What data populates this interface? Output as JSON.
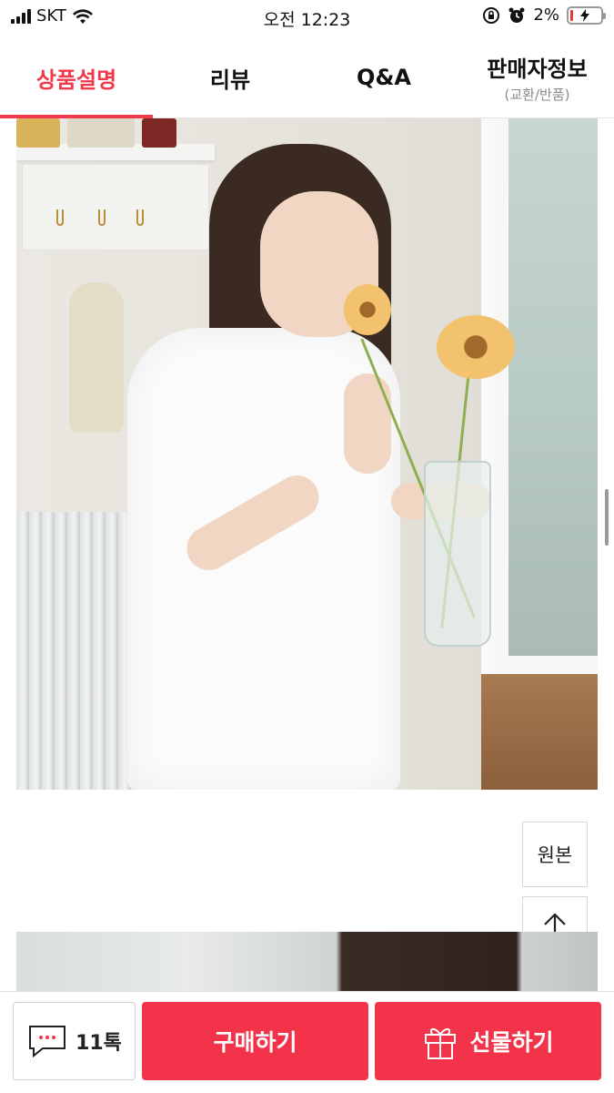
{
  "status_bar": {
    "carrier": "SKT",
    "time": "오전 12:23",
    "battery": "2%"
  },
  "tabs": [
    {
      "label": "상품설명",
      "active": true
    },
    {
      "label": "리뷰",
      "active": false
    },
    {
      "label": "Q&A",
      "active": false
    },
    {
      "label": "판매자정보",
      "sub": "(교환/반품)",
      "active": false
    }
  ],
  "side_buttons": {
    "original": "원본"
  },
  "bottom_bar": {
    "talk_label": "11톡",
    "buy_label": "구매하기",
    "gift_label": "선물하기"
  },
  "colors": {
    "accent": "#f0394b",
    "button_red": "#f3334a"
  },
  "icons": [
    "signal-icon",
    "wifi-icon",
    "lock-rotation-icon",
    "alarm-icon",
    "battery-icon",
    "arrow-up-icon",
    "chat-icon",
    "gift-icon"
  ]
}
